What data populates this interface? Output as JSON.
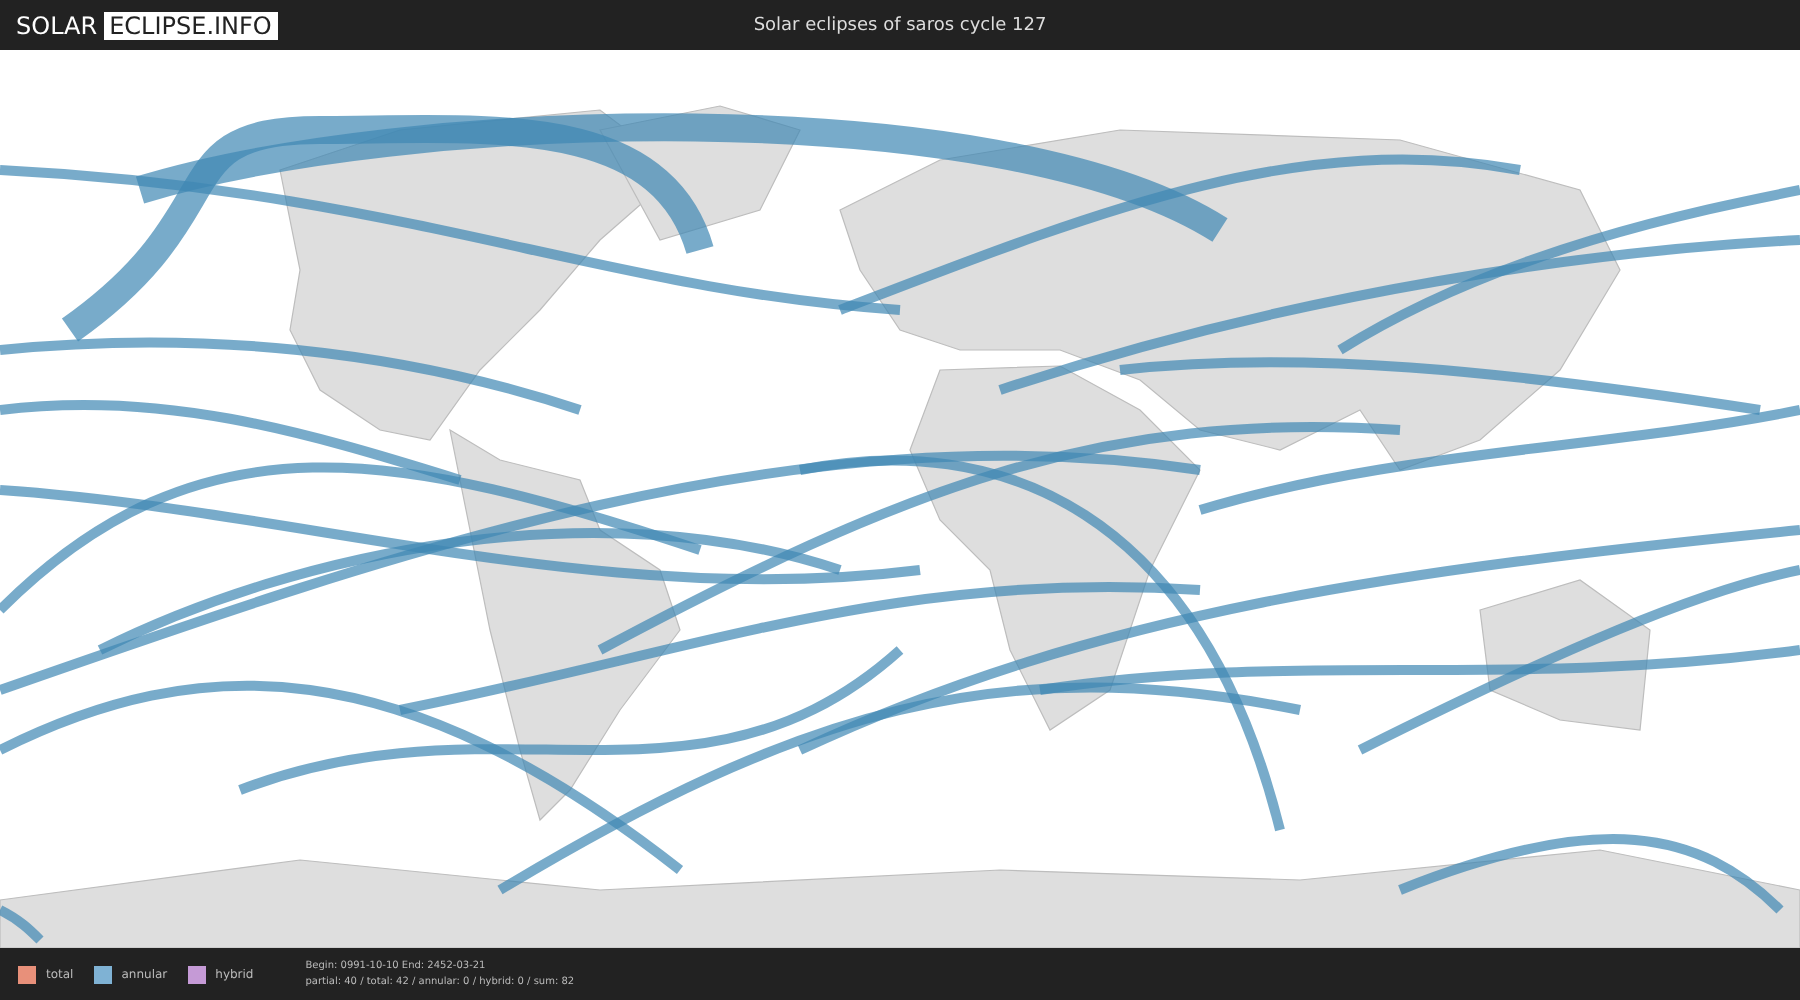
{
  "header": {
    "logo_left": "SOLAR",
    "logo_right": "ECLIPSE.INFO",
    "title": "Solar eclipses of saros cycle 127"
  },
  "legend": [
    {
      "label": "total",
      "color": "#e8907a"
    },
    {
      "label": "annular",
      "color": "#7fb2d4"
    },
    {
      "label": "hybrid",
      "color": "#c59ad6"
    }
  ],
  "stats": {
    "range": "Begin: 0991-10-10 End: 2452-03-21",
    "counts": "partial: 40 / total: 42 / annular: 0 / hybrid: 0 / sum: 82"
  }
}
